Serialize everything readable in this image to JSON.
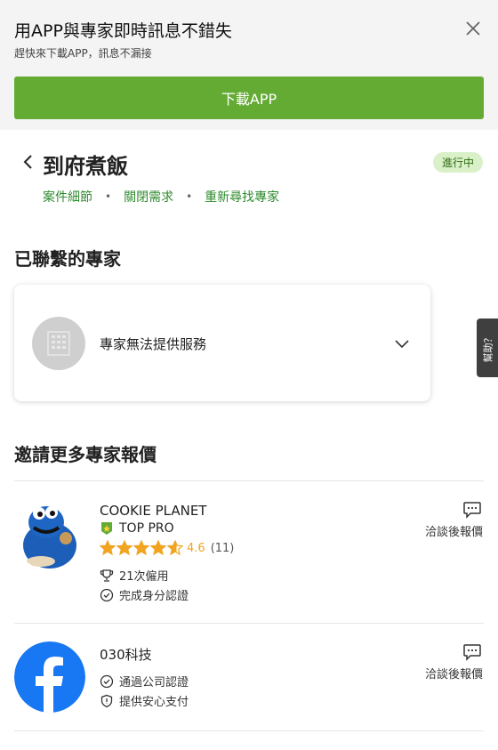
{
  "banner": {
    "title": "用APP與專家即時訊息不錯失",
    "subtitle": "趕快來下載APP，訊息不漏接",
    "download_label": "下載APP"
  },
  "request": {
    "title": "到府煮飯",
    "status": "進行中",
    "links": [
      "案件細節",
      "關閉需求",
      "重新尋找專家"
    ]
  },
  "contacted": {
    "title": "已聯繫的專家",
    "card_label": "專家無法提供服務"
  },
  "help_tab": "幫助？",
  "invite": {
    "title": "邀請更多專家報價",
    "pros": [
      {
        "name": "COOKIE PLANET",
        "badge": "TOP PRO",
        "rating": "4.6",
        "rating_count": "(11)",
        "rating_value": 4.6,
        "stats": [
          "21次僱用",
          "完成身分認證"
        ],
        "quote": "洽談後報價"
      },
      {
        "name": "030科技",
        "stats": [
          "通過公司認證",
          "提供安心支付"
        ],
        "quote": "洽談後報價"
      }
    ]
  },
  "colors": {
    "brand_green": "#64ab34",
    "link_green": "#2e8a2e",
    "status_bg": "#d9f0c8",
    "star": "#f0a420",
    "facebook_blue": "#1877f2"
  }
}
